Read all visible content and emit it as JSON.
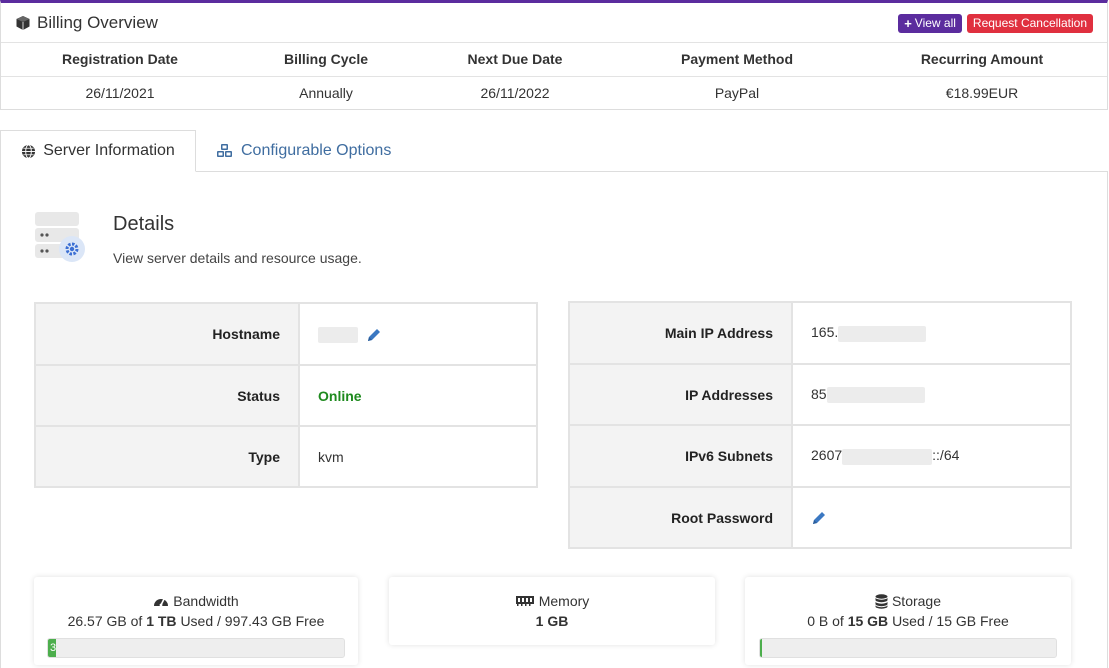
{
  "billing": {
    "title": "Billing Overview",
    "view_all_label": "View all",
    "cancel_label": "Request Cancellation",
    "columns": [
      "Registration Date",
      "Billing Cycle",
      "Next Due Date",
      "Payment Method",
      "Recurring Amount"
    ],
    "values": [
      "26/11/2021",
      "Annually",
      "26/11/2022",
      "PayPal",
      "€18.99EUR"
    ]
  },
  "tabs": [
    {
      "label": "Server Information",
      "icon": "globe-icon"
    },
    {
      "label": "Configurable Options",
      "icon": "cubes-icon"
    }
  ],
  "details": {
    "title": "Details",
    "subtitle": "View server details and resource usage."
  },
  "left_table": {
    "rows": [
      {
        "label": "Hostname",
        "value": ""
      },
      {
        "label": "Status",
        "value": "Online"
      },
      {
        "label": "Type",
        "value": "kvm"
      }
    ]
  },
  "right_table": {
    "rows": [
      {
        "label": "Main IP Address",
        "value": "165."
      },
      {
        "label": "IP Addresses",
        "value": "85"
      },
      {
        "label": "IPv6 Subnets",
        "value": "2607",
        "suffix": "::/64"
      },
      {
        "label": "Root Password",
        "value": ""
      }
    ]
  },
  "resources": {
    "bandwidth": {
      "title": "Bandwidth",
      "used": "26.57 GB",
      "of": "of",
      "total": "1 TB",
      "rest": "Used / 997.43 GB Free",
      "progress_pct": 2.66,
      "bar_text": "3"
    },
    "memory": {
      "title": "Memory",
      "value": "1 GB"
    },
    "storage": {
      "title": "Storage",
      "used": "0 B",
      "of": "of",
      "total": "15 GB",
      "rest": "Used / 15 GB Free",
      "progress_pct": 0
    }
  },
  "colors": {
    "accent": "#5b2c9e",
    "danger": "#e0303f",
    "online": "#1e8a1e",
    "link": "#3f6da0",
    "progress": "#4cae4c"
  }
}
